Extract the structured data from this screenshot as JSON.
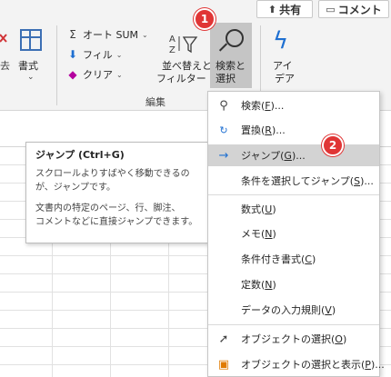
{
  "topbar": {
    "share_label": "共有",
    "comment_label": "コメント"
  },
  "ribbon": {
    "stub_label": "去",
    "format_label": "書式",
    "autosum_label": "オート SUM",
    "fill_label": "フィル",
    "clear_label": "クリア",
    "sort_label_line1": "並べ替えと",
    "sort_label_line2": "フィルター",
    "find_label_line1": "検索と",
    "find_label_line2": "選択",
    "ideas_label_line1": "アイ",
    "ideas_label_line2": "デア",
    "group_label": "編集"
  },
  "badges": {
    "first": "1",
    "second": "2"
  },
  "tooltip": {
    "title": "ジャンプ (Ctrl+G)",
    "line1": "スクロールよりすばやく移動できるの",
    "line2": "が、ジャンプです。",
    "line3": "文書内の特定のページ、行、脚注、",
    "line4": "コメントなどに直接ジャンプできます。"
  },
  "menu": {
    "find": {
      "pre": "検索(",
      "key": "F",
      "post": ")..."
    },
    "replace": {
      "pre": "置換(",
      "key": "R",
      "post": ")..."
    },
    "goto": {
      "pre": "ジャンプ(",
      "key": "G",
      "post": ")..."
    },
    "goto_special": {
      "pre": "条件を選択してジャンプ(",
      "key": "S",
      "post": ")..."
    },
    "formulas": {
      "pre": "数式(",
      "key": "U",
      "post": ")"
    },
    "notes": {
      "pre": "メモ(",
      "key": "N",
      "post": ")"
    },
    "cond_format": {
      "pre": "条件付き書式(",
      "key": "C",
      "post": ")"
    },
    "constants": {
      "pre": "定数(",
      "key": "N",
      "post": ")"
    },
    "validation": {
      "pre": "データの入力規則(",
      "key": "V",
      "post": ")"
    },
    "select_objects": {
      "pre": "オブジェクトの選択(",
      "key": "O",
      "post": ")"
    },
    "selection_pane": {
      "pre": "オブジェクトの選択と表示(",
      "key": "P",
      "post": ")..."
    }
  },
  "colors": {
    "badge": "#e03535",
    "highlight": "#d3d3d3",
    "accent": "#1e6fd1"
  }
}
